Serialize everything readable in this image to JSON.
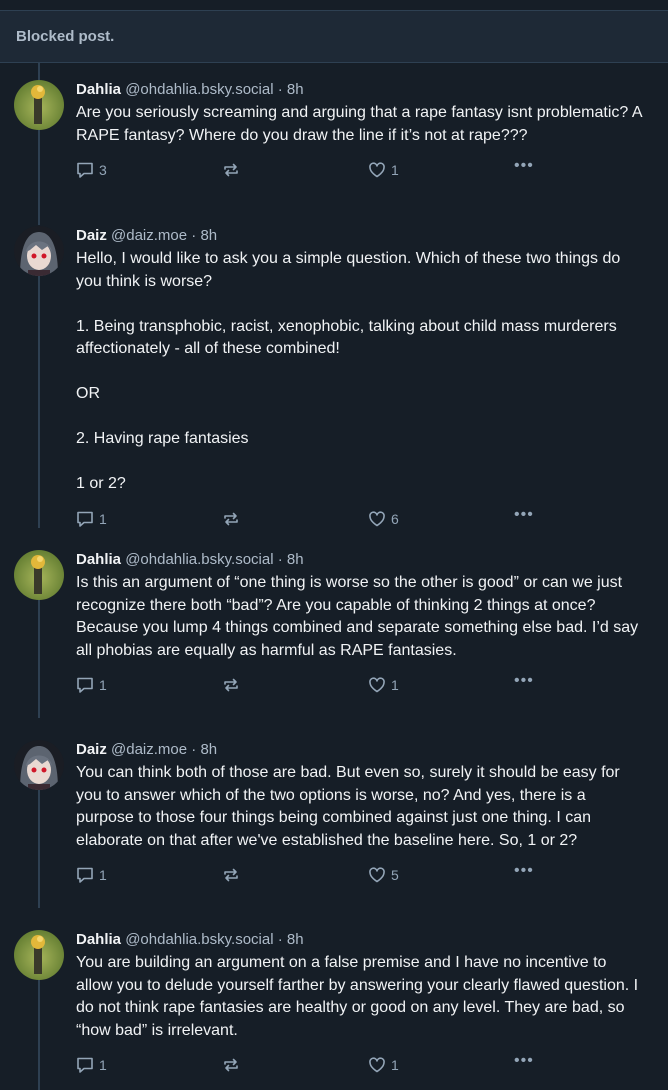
{
  "blocked_label": "Blocked post.",
  "posts": [
    {
      "author_name": "Dahlia",
      "author_handle": "@ohdahlia.bsky.social",
      "time": "8h",
      "text": "Are you seriously screaming and arguing that a rape fantasy isnt problematic? A RAPE fantasy? Where do you draw the line if it’s not at rape???",
      "replies": "3",
      "likes": "1",
      "avatar": "dahlia-avatar"
    },
    {
      "author_name": "Daiz",
      "author_handle": "@daiz.moe",
      "time": "8h",
      "text": "Hello, I would like to ask you a simple question. Which of these two things do you think is worse?\n\n1. Being transphobic, racist, xenophobic, talking about child mass murderers affectionately - all of these combined!\n\nOR\n\n2. Having rape fantasies\n\n1 or 2?",
      "replies": "1",
      "likes": "6",
      "avatar": "daiz-avatar"
    },
    {
      "author_name": "Dahlia",
      "author_handle": "@ohdahlia.bsky.social",
      "time": "8h",
      "text": "Is this an argument of “one thing is worse so the other is good” or can we just recognize there both “bad”? Are you capable of thinking 2 things at once? Because you lump 4 things combined and separate something else bad. I’d say all phobias are equally as harmful as RAPE fantasies.",
      "replies": "1",
      "likes": "1",
      "avatar": "dahlia-avatar"
    },
    {
      "author_name": "Daiz",
      "author_handle": "@daiz.moe",
      "time": "8h",
      "text": "You can think both of those are bad. But even so, surely it should be easy for you to answer which of the two options is worse, no? And yes, there is a purpose to those four things being combined against just one thing. I can elaborate on that after we've established the baseline here. So, 1 or 2?",
      "replies": "1",
      "likes": "5",
      "avatar": "daiz-avatar"
    },
    {
      "author_name": "Dahlia",
      "author_handle": "@ohdahlia.bsky.social",
      "time": "8h",
      "text": "You are building an argument on a false premise and I have no incentive to allow you to delude yourself farther by answering your clearly flawed question. I do not think rape fantasies are healthy or good on any level. They are bad, so “how bad” is irrelevant.",
      "replies": "1",
      "likes": "1",
      "avatar": "dahlia-avatar"
    }
  ],
  "colors": {
    "background": "#161e27",
    "blocked_bg": "#1e2936",
    "muted": "#93a5b7",
    "border": "#2e4052"
  }
}
